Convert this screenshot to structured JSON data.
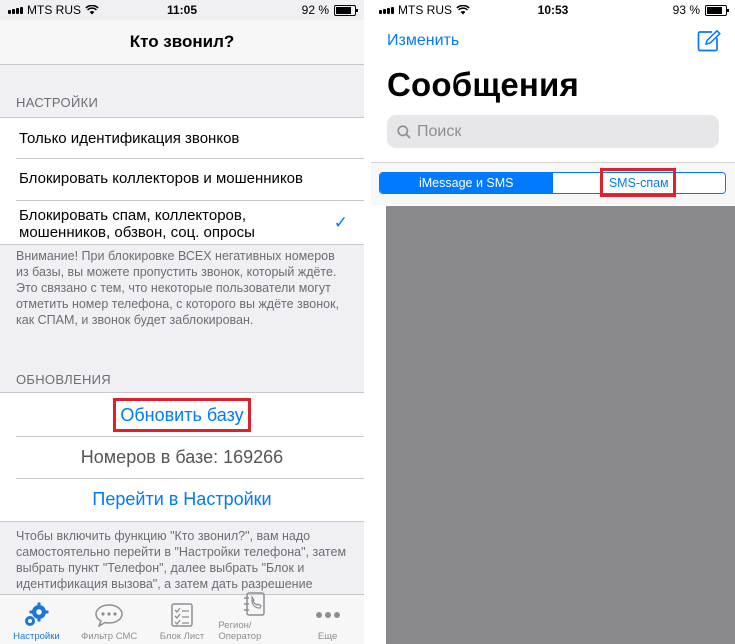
{
  "left": {
    "status": {
      "carrier": "MTS RUS",
      "time": "11:05",
      "battery": "92 %",
      "battery_level": 0.92
    },
    "nav_title": "Кто звонил?",
    "settings_header": "НАСТРОЙКИ",
    "options": [
      {
        "label": "Только идентификация звонков"
      },
      {
        "label": "Блокировать коллекторов и мошенников"
      },
      {
        "label": "Блокировать спам, коллекторов, мошенников, обзвон, соц. опросы",
        "checked": true
      }
    ],
    "warning": "Внимание! При блокировке ВСЕХ негативных номеров из базы, вы можете пропустить звонок, который ждёте. Это связано с тем, что некоторые пользователи могут отметить номер телефона, с которого вы ждёте звонок, как СПАМ, и звонок будет заблокирован.",
    "updates_header": "ОБНОВЛЕНИЯ",
    "update_button": "Обновить базу",
    "count_text": "Номеров в базе: 169266",
    "settings_link": "Перейти в Настройки",
    "instruction": "Чтобы включить функцию \"Кто звонил?\", вам надо самостоятельно перейти в \"Настройки телефона\", затем выбрать пункт \"Телефон\", далее выбрать \"Блок и идентификация вызова\", а затем дать разрешение нашей программе.",
    "tabs": [
      {
        "label": "Настройки",
        "icon": "gears-icon",
        "active": true
      },
      {
        "label": "Фильтр СМС",
        "icon": "chat-bubble-icon"
      },
      {
        "label": "Блок Лист",
        "icon": "checklist-icon"
      },
      {
        "label": "Регион/Оператор",
        "icon": "phone-book-icon"
      },
      {
        "label": "Еще",
        "icon": "more-dots-icon"
      }
    ],
    "colors": {
      "accent": "#007aff",
      "highlight": "#e0202c",
      "tab_active": "#1b76d6"
    }
  },
  "right": {
    "status": {
      "carrier": "MTS RUS",
      "time": "10:53",
      "battery": "93 %",
      "battery_level": 0.93
    },
    "edit": "Изменить",
    "title": "Сообщения",
    "search_placeholder": "Поиск",
    "segments": [
      "iMessage и SMS",
      "SMS-спам"
    ],
    "selected_segment": 0
  }
}
